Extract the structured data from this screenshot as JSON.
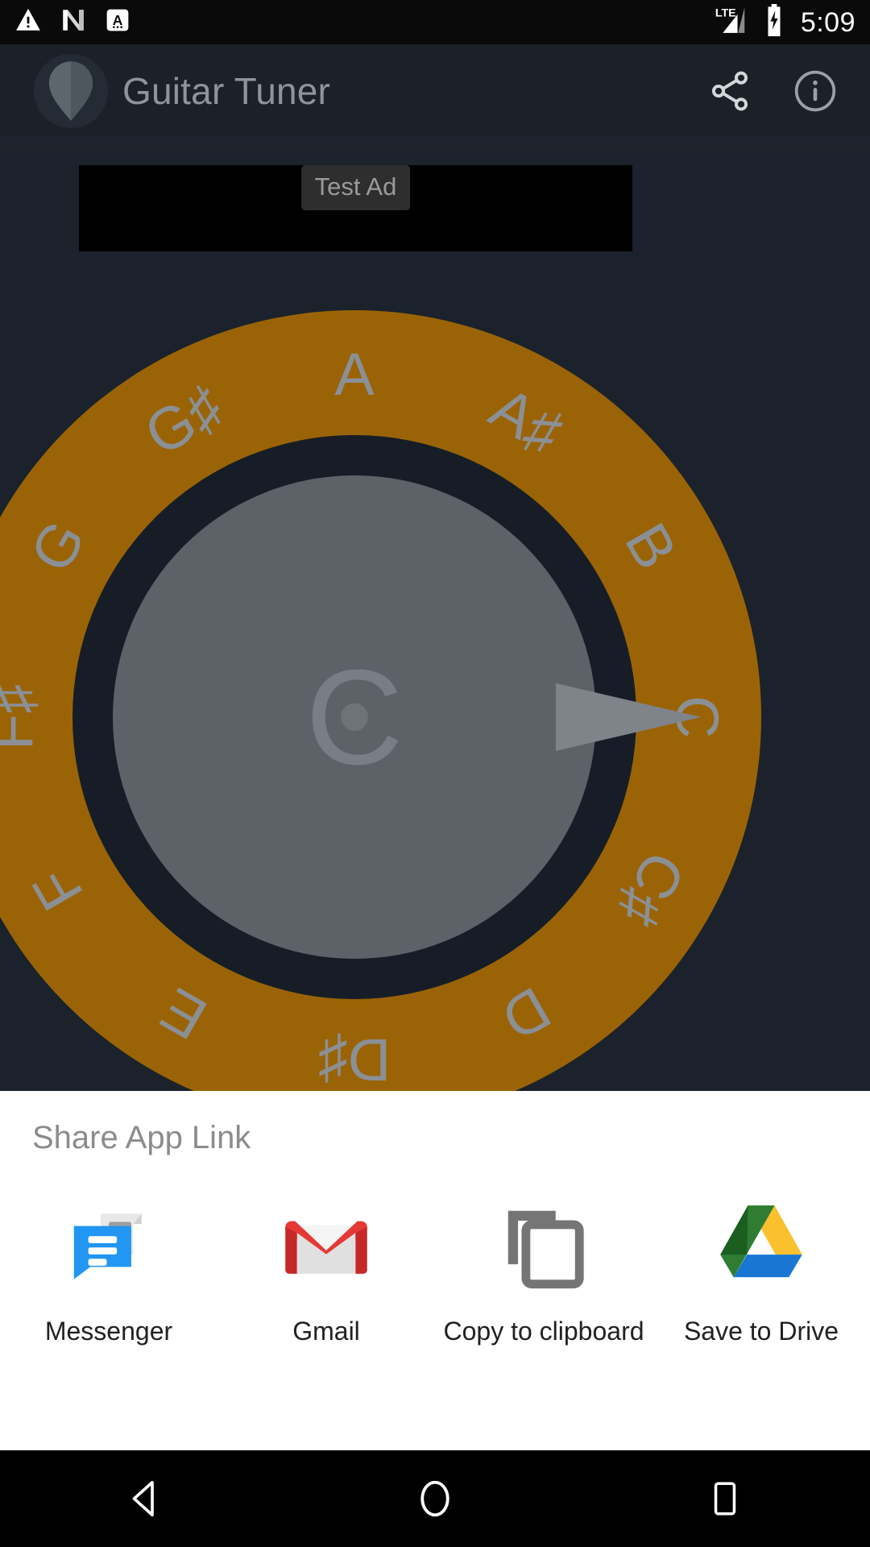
{
  "status_bar": {
    "icons": [
      "warning-triangle-icon",
      "android-nougat-icon",
      "accessibility-a-icon"
    ],
    "network": "LTE",
    "battery": "charging",
    "time": "5:09"
  },
  "app_bar": {
    "logo": "guitar-pick-icon",
    "title": "Guitar Tuner",
    "actions": [
      {
        "name": "share-icon",
        "label": "Share"
      },
      {
        "name": "info-icon",
        "label": "Info"
      }
    ]
  },
  "ad": {
    "label": "Test Ad"
  },
  "tuner": {
    "current_note": "C",
    "needle_angle_deg": 0,
    "ring_color": "#9a6406",
    "notes": [
      {
        "label": "A",
        "angle": -90
      },
      {
        "label": "A♯",
        "angle": -60
      },
      {
        "label": "B",
        "angle": -30
      },
      {
        "label": "C",
        "angle": 0
      },
      {
        "label": "C♯",
        "angle": 30
      },
      {
        "label": "D",
        "angle": 60
      },
      {
        "label": "D♯",
        "angle": 90
      },
      {
        "label": "E",
        "angle": 120
      },
      {
        "label": "F",
        "angle": 150
      },
      {
        "label": "F♯",
        "angle": 180
      },
      {
        "label": "G",
        "angle": -150
      },
      {
        "label": "G♯",
        "angle": -120
      }
    ]
  },
  "share_sheet": {
    "title": "Share App Link",
    "targets": [
      {
        "label": "Messenger",
        "icon": "messenger-icon"
      },
      {
        "label": "Gmail",
        "icon": "gmail-icon"
      },
      {
        "label": "Copy to clipboard",
        "icon": "copy-icon"
      },
      {
        "label": "Save to Drive",
        "icon": "google-drive-icon"
      }
    ]
  },
  "nav_bar": {
    "buttons": [
      {
        "name": "back-button",
        "icon": "back-triangle-icon"
      },
      {
        "name": "home-button",
        "icon": "home-circle-icon"
      },
      {
        "name": "recents-button",
        "icon": "recents-square-icon"
      }
    ]
  }
}
